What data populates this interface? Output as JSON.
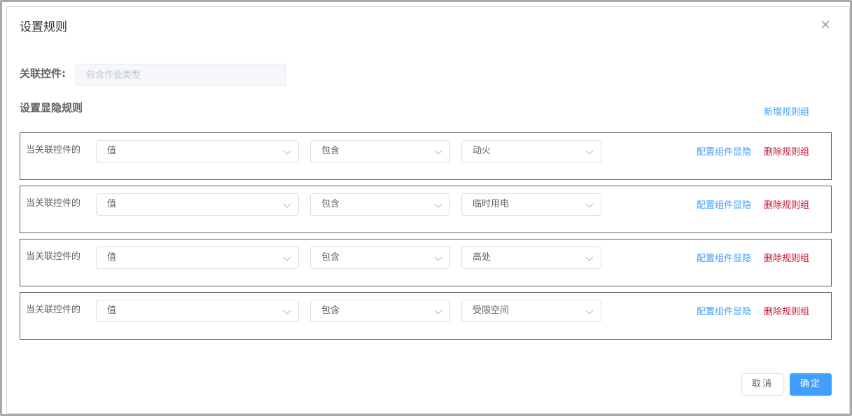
{
  "dialog": {
    "title": "设置规则"
  },
  "linked_control": {
    "label": "关联控件:",
    "placeholder": "包含作业类型",
    "value": ""
  },
  "rules": {
    "heading": "设置显隐规则",
    "add_group_label": "新增规则组",
    "groups": [
      {
        "prefix": "当关联控件的",
        "field": "值",
        "operator": "包含",
        "value": "动火",
        "config_label": "配置组件显隐",
        "delete_label": "删除规则组"
      },
      {
        "prefix": "当关联控件的",
        "field": "值",
        "operator": "包含",
        "value": "临时用电",
        "config_label": "配置组件显隐",
        "delete_label": "删除规则组"
      },
      {
        "prefix": "当关联控件的",
        "field": "值",
        "operator": "包含",
        "value": "高处",
        "config_label": "配置组件显隐",
        "delete_label": "删除规则组"
      },
      {
        "prefix": "当关联控件的",
        "field": "值",
        "operator": "包含",
        "value": "受限空间",
        "config_label": "配置组件显隐",
        "delete_label": "删除规则组"
      }
    ]
  },
  "footer": {
    "cancel_label": "取消",
    "ok_label": "确定"
  },
  "colors": {
    "primary": "#409eff",
    "danger": "#c0152f"
  }
}
